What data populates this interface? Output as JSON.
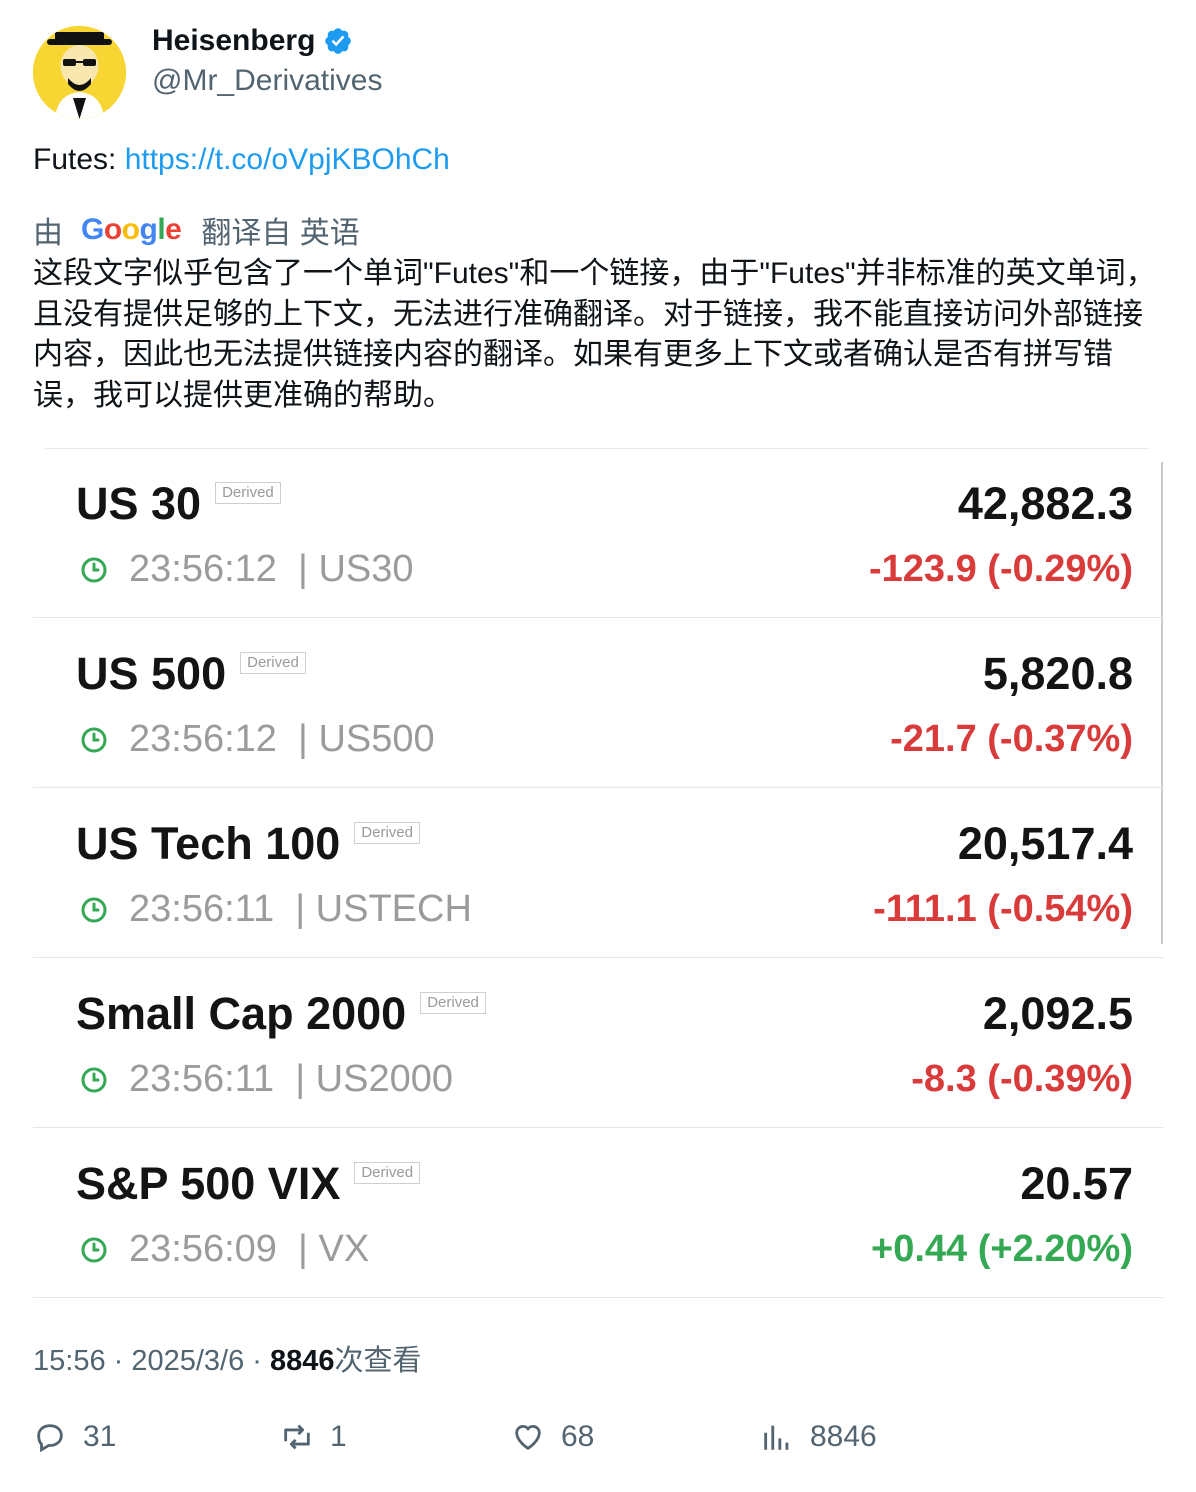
{
  "author": {
    "name": "Heisenberg",
    "handle": "@Mr_Derivatives"
  },
  "tweet": {
    "prefix": "Futes: ",
    "link": "https://t.co/oVpjKBOhCh"
  },
  "translation": {
    "by": "由",
    "google_label": [
      "G",
      "o",
      "o",
      "g",
      "l",
      "e"
    ],
    "from_label": "翻译自 英语",
    "text": "这段文字似乎包含了一个单词\"Futes\"和一个链接，由于\"Futes\"并非标准的英文单词，且没有提供足够的上下文，无法进行准确翻译。对于链接，我不能直接访问外部链接内容，因此也无法提供链接内容的翻译。如果有更多上下文或者确认是否有拼写错误，我可以提供更准确的帮助。"
  },
  "quotes": [
    {
      "name": "US 30",
      "badge": "Derived",
      "time": "23:56:12",
      "symbol": "| US30",
      "price": "42,882.3",
      "change": "-123.9 (-0.29%)",
      "direction": "down"
    },
    {
      "name": "US 500",
      "badge": "Derived",
      "time": "23:56:12",
      "symbol": "| US500",
      "price": "5,820.8",
      "change": "-21.7 (-0.37%)",
      "direction": "down"
    },
    {
      "name": "US Tech 100",
      "badge": "Derived",
      "time": "23:56:11",
      "symbol": "| USTECH",
      "price": "20,517.4",
      "change": "-111.1 (-0.54%)",
      "direction": "down"
    },
    {
      "name": "Small Cap 2000",
      "badge": "Derived",
      "time": "23:56:11",
      "symbol": "| US2000",
      "price": "2,092.5",
      "change": "-8.3 (-0.39%)",
      "direction": "down"
    },
    {
      "name": "S&P 500 VIX",
      "badge": "Derived",
      "time": "23:56:09",
      "symbol": "| VX",
      "price": "20.57",
      "change": "+0.44 (+2.20%)",
      "direction": "up"
    }
  ],
  "meta": {
    "time": "15:56",
    "sep1": " · ",
    "date": "2025/3/6",
    "sep2": " · ",
    "views_count": "8846",
    "views_label": "次查看"
  },
  "actions": {
    "replies": "31",
    "reposts": "1",
    "likes": "68",
    "views": "8846"
  },
  "colors": {
    "link": "#1d9bf0",
    "negative": "#d93a3a",
    "positive": "#34a853",
    "clock": "#34a853"
  }
}
